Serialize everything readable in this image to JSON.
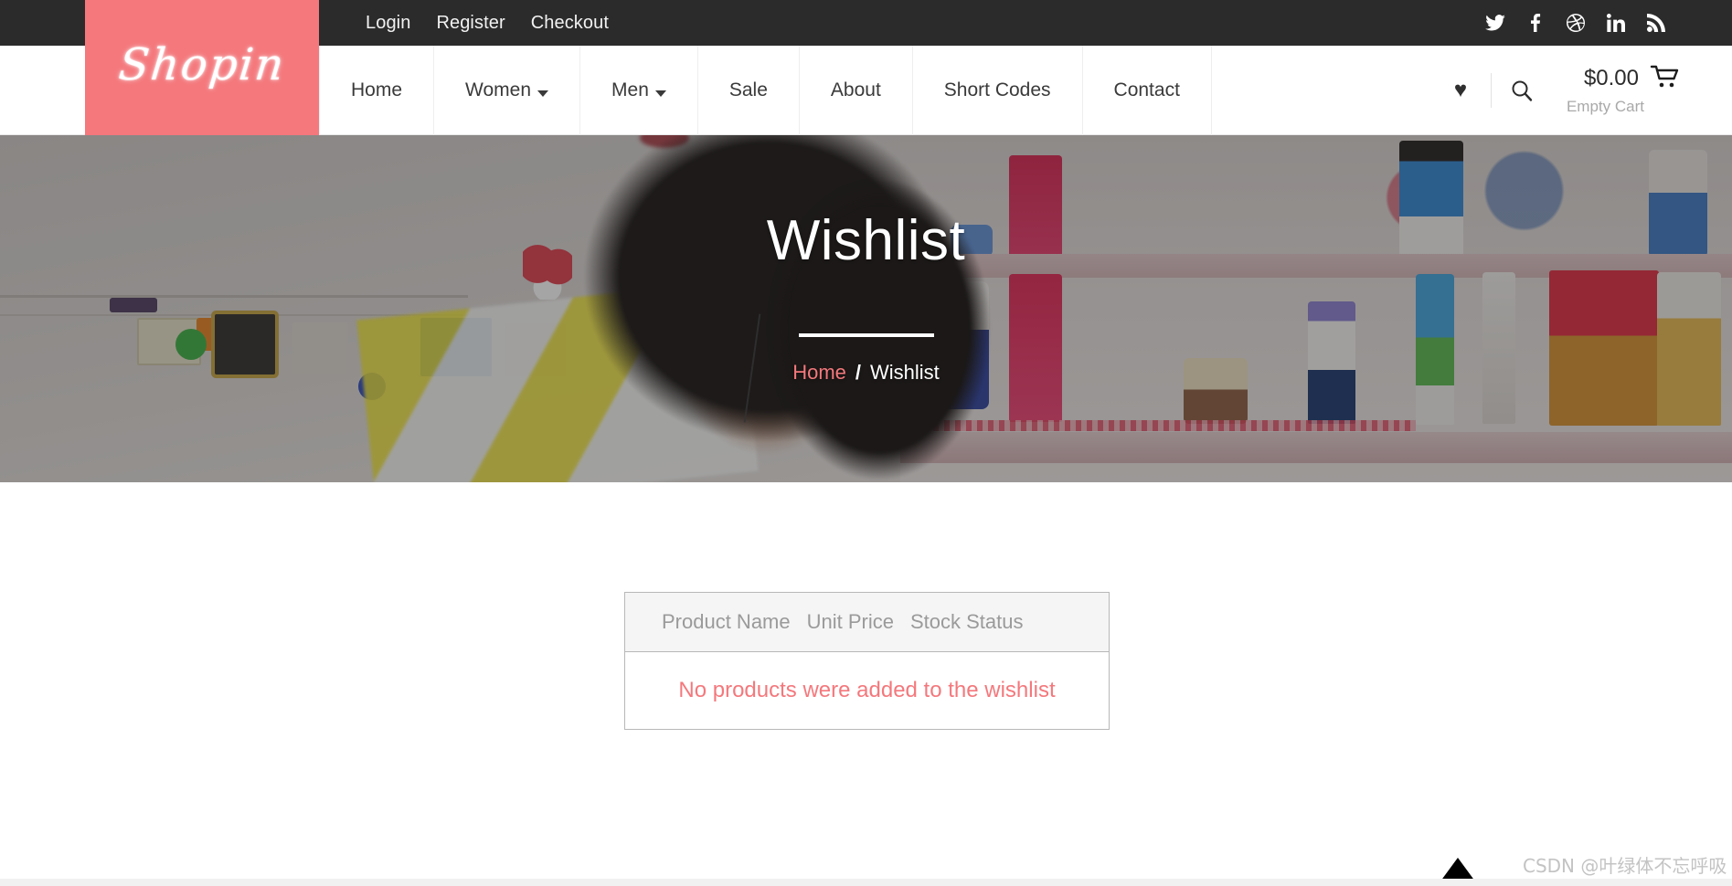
{
  "topbar": {
    "links": [
      {
        "label": "Login",
        "name": "login-link"
      },
      {
        "label": "Register",
        "name": "register-link"
      },
      {
        "label": "Checkout",
        "name": "checkout-link"
      }
    ],
    "social": [
      {
        "icon": "twitter-icon"
      },
      {
        "icon": "facebook-icon"
      },
      {
        "icon": "dribbble-icon"
      },
      {
        "icon": "linkedin-icon"
      },
      {
        "icon": "rss-icon"
      }
    ]
  },
  "brand": {
    "logo_text": "Shopin",
    "logo_bg": "#f4787c"
  },
  "nav": {
    "items": [
      {
        "label": "Home",
        "has_caret": false
      },
      {
        "label": "Women",
        "has_caret": true
      },
      {
        "label": "Men",
        "has_caret": true
      },
      {
        "label": "Sale",
        "has_caret": false
      },
      {
        "label": "About",
        "has_caret": false
      },
      {
        "label": "Short Codes",
        "has_caret": false
      },
      {
        "label": "Contact",
        "has_caret": false
      }
    ],
    "wishlist_icon": "heart-icon",
    "search_icon": "search-icon",
    "cart_icon": "cart-icon",
    "cart_total": "$0.00",
    "cart_status": "Empty Cart"
  },
  "hero": {
    "title": "Wishlist",
    "breadcrumb": {
      "home": "Home",
      "separator": "/",
      "current": "Wishlist"
    },
    "accent_color": "#f4787c"
  },
  "wishlist": {
    "columns": [
      "Product Name",
      "Unit Price",
      "Stock Status"
    ],
    "rows": [],
    "empty_message": "No products were added to the wishlist",
    "empty_color": "#f4787c"
  },
  "footer": {
    "scroll_top_icon": "scroll-to-top-arrow-icon",
    "watermark": "CSDN @叶绿体不忘呼吸"
  }
}
